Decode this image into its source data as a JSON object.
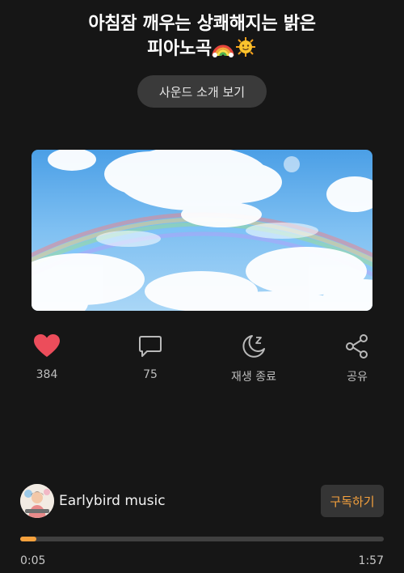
{
  "title": {
    "line1": "아침잠 깨우는 상쾌해지는 밝은",
    "line2": "피아노곡"
  },
  "title_emojis": [
    "rainbow-emoji",
    "sun-emoji"
  ],
  "sound_button": {
    "label": "사운드 소개 보기"
  },
  "actions": [
    {
      "icon": "heart-icon",
      "label": "384",
      "color": "#ec4d5b"
    },
    {
      "icon": "comment-icon",
      "label": "75"
    },
    {
      "icon": "sleep-timer-icon",
      "label": "재생 종료"
    },
    {
      "icon": "share-icon",
      "label": "공유"
    }
  ],
  "channel": {
    "name": "Earlybird music",
    "subscribe_label": "구독하기",
    "accent": "#f5a13d"
  },
  "player": {
    "current_time": "0:05",
    "total_time": "1:57",
    "progress": 0.044
  }
}
